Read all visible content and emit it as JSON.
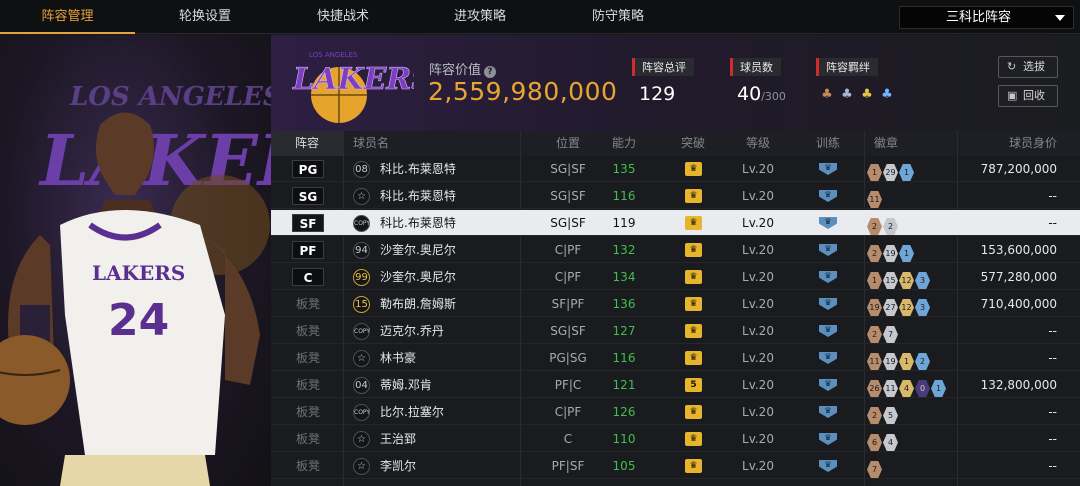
{
  "nav": {
    "tabs": [
      "阵容管理",
      "轮换设置",
      "快捷战术",
      "进攻策略",
      "防守策略"
    ],
    "active": 0,
    "lineup_select": "三科比阵容"
  },
  "header": {
    "value_label": "阵容价值",
    "value": "2,559,980,000",
    "stats": [
      {
        "label": "阵容总评",
        "value": "129",
        "suffix": ""
      },
      {
        "label": "球员数",
        "value": "40",
        "suffix": "/300"
      },
      {
        "label": "阵容羁绊",
        "value": "",
        "suffix": ""
      }
    ],
    "buttons": {
      "scout": "选拔",
      "recycle": "回收"
    }
  },
  "table": {
    "headers": [
      "阵容",
      "球员名",
      "位置",
      "能力",
      "突破",
      "等级",
      "训练",
      "徽章",
      "球员身价"
    ],
    "rows": [
      {
        "pos": "PG",
        "starter": true,
        "jersey": "08",
        "name": "科比.布莱恩特",
        "position": "SG|SF",
        "ability": "135",
        "breakthrough": "",
        "level": "Lv.20",
        "badges": [
          {
            "c": "br",
            "n": "1"
          },
          {
            "c": "si",
            "n": "29"
          },
          {
            "c": "bl",
            "n": "1"
          }
        ],
        "worth": "787,200,000"
      },
      {
        "pos": "SG",
        "starter": true,
        "jersey": "☆",
        "name": "科比.布莱恩特",
        "position": "SG|SF",
        "ability": "116",
        "breakthrough": "",
        "level": "Lv.20",
        "badges": [
          {
            "c": "br",
            "n": "11"
          }
        ],
        "worth": "--"
      },
      {
        "pos": "SF",
        "starter": true,
        "jersey": "COPY",
        "name": "科比.布莱恩特",
        "position": "SG|SF",
        "ability": "119",
        "breakthrough": "",
        "level": "Lv.20",
        "badges": [
          {
            "c": "br",
            "n": "2"
          },
          {
            "c": "si",
            "n": "2"
          }
        ],
        "worth": "--",
        "selected": true
      },
      {
        "pos": "PF",
        "starter": true,
        "jersey": "94",
        "name": "沙奎尔.奥尼尔",
        "position": "C|PF",
        "ability": "132",
        "breakthrough": "",
        "level": "Lv.20",
        "badges": [
          {
            "c": "br",
            "n": "2"
          },
          {
            "c": "si",
            "n": "19"
          },
          {
            "c": "bl",
            "n": "1"
          }
        ],
        "worth": "153,600,000"
      },
      {
        "pos": "C",
        "starter": true,
        "jersey": "99",
        "name": "沙奎尔.奥尼尔",
        "position": "C|PF",
        "ability": "134",
        "breakthrough": "",
        "level": "Lv.20",
        "badges": [
          {
            "c": "br",
            "n": "1"
          },
          {
            "c": "si",
            "n": "15"
          },
          {
            "c": "go",
            "n": "12"
          },
          {
            "c": "bl",
            "n": "3"
          }
        ],
        "worth": "577,280,000"
      },
      {
        "pos": "板凳",
        "starter": false,
        "jersey": "15",
        "name": "勒布朗.詹姆斯",
        "position": "SF|PF",
        "ability": "136",
        "breakthrough": "",
        "level": "Lv.20",
        "badges": [
          {
            "c": "br",
            "n": "19"
          },
          {
            "c": "si",
            "n": "27"
          },
          {
            "c": "go",
            "n": "12"
          },
          {
            "c": "bl",
            "n": "3"
          }
        ],
        "worth": "710,400,000"
      },
      {
        "pos": "板凳",
        "starter": false,
        "jersey": "COPY",
        "name": "迈克尔.乔丹",
        "position": "SG|SF",
        "ability": "127",
        "breakthrough": "",
        "level": "Lv.20",
        "badges": [
          {
            "c": "br",
            "n": "2"
          },
          {
            "c": "si",
            "n": "7"
          }
        ],
        "worth": "--"
      },
      {
        "pos": "板凳",
        "starter": false,
        "jersey": "☆",
        "name": "林书豪",
        "position": "PG|SG",
        "ability": "116",
        "breakthrough": "",
        "level": "Lv.20",
        "badges": [
          {
            "c": "br",
            "n": "11"
          },
          {
            "c": "si",
            "n": "19"
          },
          {
            "c": "go",
            "n": "1"
          },
          {
            "c": "bl",
            "n": "2"
          }
        ],
        "worth": "--"
      },
      {
        "pos": "板凳",
        "starter": false,
        "jersey": "04",
        "name": "蒂姆.邓肯",
        "position": "PF|C",
        "ability": "121",
        "breakthrough": "5",
        "level": "Lv.20",
        "badges": [
          {
            "c": "br",
            "n": "26"
          },
          {
            "c": "si",
            "n": "11"
          },
          {
            "c": "go",
            "n": "4"
          },
          {
            "c": "pu",
            "n": "0"
          },
          {
            "c": "bl",
            "n": "1"
          }
        ],
        "worth": "132,800,000"
      },
      {
        "pos": "板凳",
        "starter": false,
        "jersey": "COPY",
        "name": "比尔.拉塞尔",
        "position": "C|PF",
        "ability": "126",
        "breakthrough": "",
        "level": "Lv.20",
        "badges": [
          {
            "c": "br",
            "n": "2"
          },
          {
            "c": "si",
            "n": "5"
          }
        ],
        "worth": "--"
      },
      {
        "pos": "板凳",
        "starter": false,
        "jersey": "☆",
        "name": "王治郅",
        "position": "C",
        "ability": "110",
        "breakthrough": "",
        "level": "Lv.20",
        "badges": [
          {
            "c": "br",
            "n": "6"
          },
          {
            "c": "si",
            "n": "4"
          }
        ],
        "worth": "--"
      },
      {
        "pos": "板凳",
        "starter": false,
        "jersey": "☆",
        "name": "李凯尔",
        "position": "PF|SF",
        "ability": "105",
        "breakthrough": "",
        "level": "Lv.20",
        "badges": [
          {
            "c": "br",
            "n": "7"
          }
        ],
        "worth": "--"
      }
    ]
  },
  "logo_text": "LAKERS",
  "logo_sub": "LOS ANGELES",
  "jersey_text": "LAKERS",
  "jersey_number": "24"
}
